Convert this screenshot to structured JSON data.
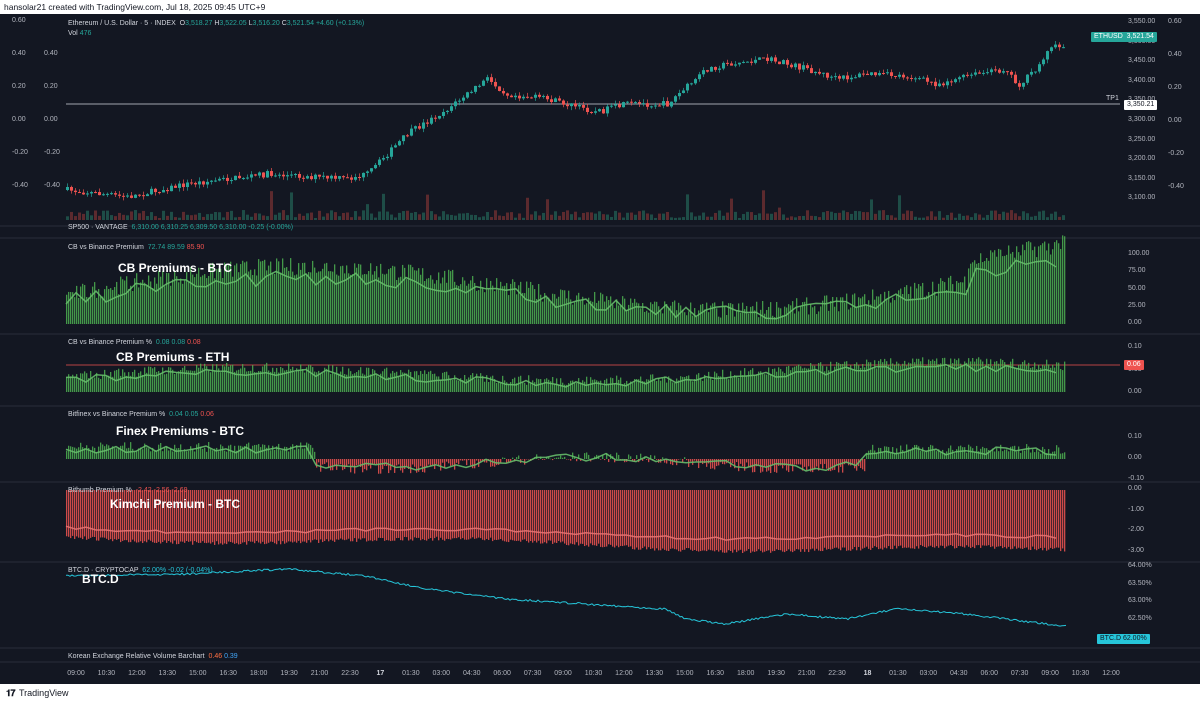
{
  "header": {
    "credit": "hansolar21 created with TradingView.com, Jul 18, 2025 09:45 UTC+9"
  },
  "main": {
    "symbol": "Ethereum / U.S. Dollar · 5 · INDEX",
    "o_label": "O",
    "o": "3,518.27",
    "h_label": "H",
    "h": "3,522.05",
    "l_label": "L",
    "l": "3,516.20",
    "c_label": "C",
    "c": "3,521.54",
    "change": "+4.60 (+0.13%)",
    "vol_label": "Vol",
    "vol": "476",
    "price_badge_label": "ETHUSD",
    "price_badge_value": "3,521.54",
    "tp_label": "TP1",
    "tp_value": "3,350.21",
    "right_axis": [
      "3,550.00",
      "3,500.00",
      "3,450.00",
      "3,400.00",
      "3,350.00",
      "3,300.00",
      "3,250.00",
      "3,200.00",
      "3,150.00",
      "3,100.00"
    ],
    "left_axis_outer": [
      "0.60",
      "0.40",
      "0.20",
      "0.00",
      "-0.20",
      "-0.40"
    ],
    "left_axis_inner": [
      "0.40",
      "0.20",
      "0.00",
      "-0.20",
      "-0.40"
    ],
    "right_axis_extra": [
      "0.60",
      "0.40",
      "0.20",
      "0.00",
      "-0.20",
      "-0.40"
    ]
  },
  "sp500": {
    "label": "SP500 · VANTAGE",
    "v1": "6,310.00",
    "v2": "6,310.25",
    "v3": "6,309.50",
    "v4": "6,310.00",
    "chg": "-0.25 (-0.00%)"
  },
  "cb_btc": {
    "label": "CB vs Binance Premium",
    "v1": "72.74",
    "v2": "89.59",
    "v3": "85.90",
    "title": "CB Premiums - BTC",
    "axis": [
      "100.00",
      "75.00",
      "50.00",
      "25.00",
      "0.00"
    ]
  },
  "cb_eth": {
    "label": "CB vs Binance Premium %",
    "v1": "0.08",
    "v2": "0.08",
    "v3": "0.08",
    "title": "CB Premiums - ETH",
    "axis": [
      "0.10",
      "0.05",
      "0.00"
    ],
    "badge": "0.06"
  },
  "finex": {
    "label": "Bitfinex vs Binance Premium %",
    "v1": "0.04",
    "v2": "0.05",
    "v3": "0.06",
    "title": "Finex Premiums - BTC",
    "axis": [
      "0.10",
      "0.00",
      "-0.10"
    ]
  },
  "kimchi": {
    "label": "Bithumb Premium %",
    "v1": "-2.42",
    "v2": "-2.56",
    "v3": "-2.69",
    "title": "Kimchi Premium - BTC",
    "axis": [
      "0.00",
      "-1.00",
      "-2.00",
      "-3.00"
    ]
  },
  "btcd": {
    "label": "BTC.D · CRYPTOCAP",
    "v1": "62.00%",
    "chg": "-0.02 (-0.04%)",
    "title": "BTC.D",
    "axis": [
      "64.00%",
      "63.50%",
      "63.00%",
      "62.50%"
    ],
    "badge_label": "BTC.D",
    "badge_value": "62.00%"
  },
  "korean": {
    "label": "Korean Exchange Relative Volume Barchart",
    "v1": "0.46",
    "v2": "0.39"
  },
  "time_axis": [
    "09:00",
    "10:30",
    "12:00",
    "13:30",
    "15:00",
    "16:30",
    "18:00",
    "19:30",
    "21:00",
    "22:30",
    "17",
    "01:30",
    "03:00",
    "04:30",
    "06:00",
    "07:30",
    "09:00",
    "10:30",
    "12:00",
    "13:30",
    "15:00",
    "16:30",
    "18:00",
    "19:30",
    "21:00",
    "22:30",
    "18",
    "01:30",
    "03:00",
    "04:30",
    "06:00",
    "07:30",
    "09:00",
    "10:30",
    "12:00"
  ],
  "footer": {
    "brand": "TradingView"
  },
  "colors": {
    "bg": "#131722",
    "up": "#26a69a",
    "down": "#ef5350",
    "premium_up": "#4caf50",
    "premium_down": "#ef5350",
    "btcd_line": "#26c6da"
  }
}
